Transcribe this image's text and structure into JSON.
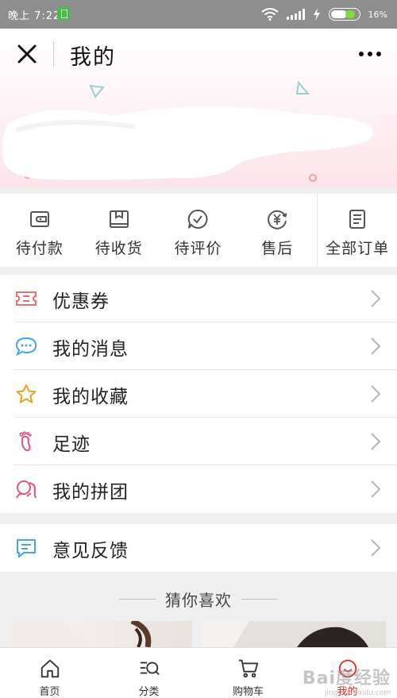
{
  "status_bar": {
    "time": "晚上 7:22",
    "battery_pct": "16%"
  },
  "header": {
    "title": "我的"
  },
  "orders": [
    {
      "label": "待付款",
      "icon": "wallet-icon"
    },
    {
      "label": "待收货",
      "icon": "package-icon"
    },
    {
      "label": "待评价",
      "icon": "review-icon"
    },
    {
      "label": "售后",
      "icon": "refund-yen-icon"
    },
    {
      "label": "全部订单",
      "icon": "order-list-icon"
    }
  ],
  "menu": [
    {
      "label": "优惠券",
      "icon": "coupon-icon",
      "color": "#e8706f"
    },
    {
      "label": "我的消息",
      "icon": "message-icon",
      "color": "#42a4e8"
    },
    {
      "label": "我的收藏",
      "icon": "star-icon",
      "color": "#f0a020"
    },
    {
      "label": "足迹",
      "icon": "footprint-icon",
      "color": "#e8507a"
    },
    {
      "label": "我的拼团",
      "icon": "group-icon",
      "color": "#e8507a"
    }
  ],
  "feedback": {
    "label": "意见反馈",
    "icon": "feedback-icon",
    "color": "#42a4e8"
  },
  "recommend": {
    "title": "猜你喜欢"
  },
  "tabbar": [
    {
      "label": "首页",
      "icon": "home-icon"
    },
    {
      "label": "分类",
      "icon": "category-search-icon"
    },
    {
      "label": "购物车",
      "icon": "cart-icon"
    },
    {
      "label": "我的",
      "icon": "profile-smile-icon",
      "active": true
    }
  ],
  "watermark": {
    "text": "Bai度经验",
    "sub": "jingyan.baidu.com"
  }
}
